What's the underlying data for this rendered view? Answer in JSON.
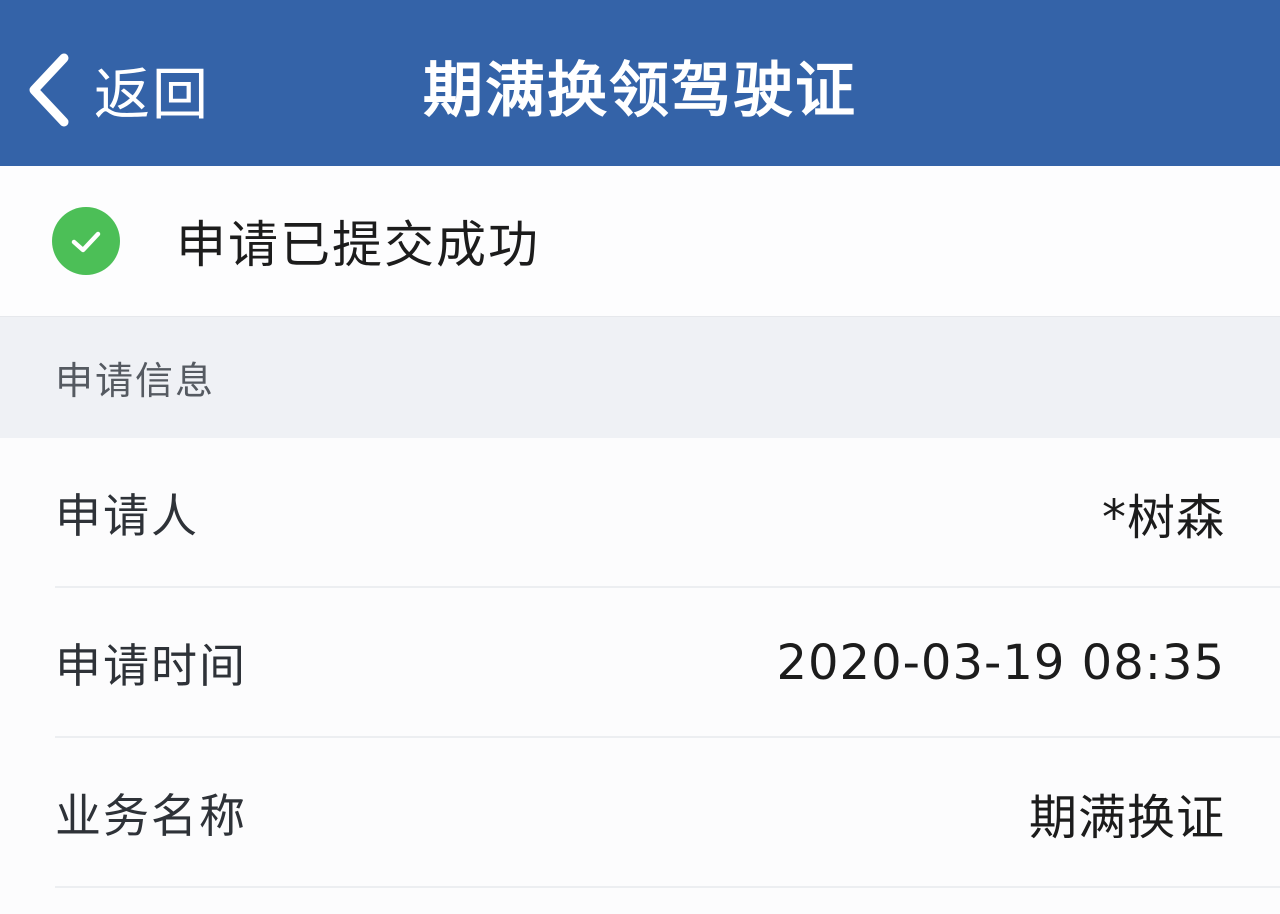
{
  "navbar": {
    "back_label": "返回",
    "title": "期满换领驾驶证",
    "background_color": "#3463a8",
    "back_icon": "chevron-left-icon"
  },
  "status": {
    "text": "申请已提交成功",
    "icon": "check-circle-icon",
    "icon_color": "#4cbf57"
  },
  "section": {
    "label": "申请信息"
  },
  "info_rows": [
    {
      "label": "申请人",
      "value": "*树森"
    },
    {
      "label": "申请时间",
      "value": "2020-03-19 08:35"
    },
    {
      "label": "业务名称",
      "value": "期满换证"
    }
  ]
}
